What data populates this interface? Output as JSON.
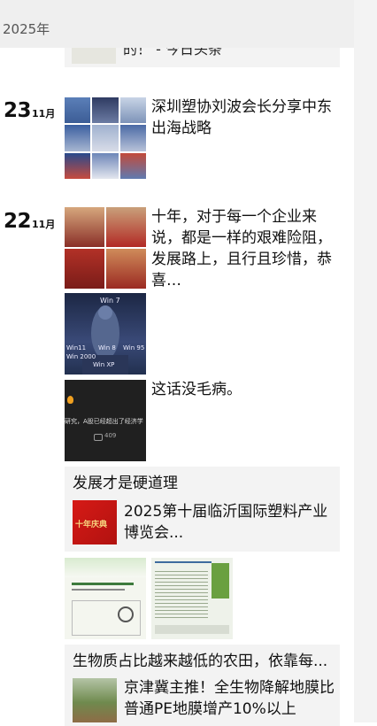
{
  "header": {
    "year": "2025年"
  },
  "top_card": {
    "text": "的！ - 今日头条"
  },
  "posts": [
    {
      "day": "23",
      "month": "11月",
      "text": "深圳塑协刘波会长分享中东出海战略"
    },
    {
      "day": "22",
      "month": "11月",
      "text": "十年，对于每一个企业来说，都是一样的艰难险阻，发展路上，且行且珍惜，恭喜…",
      "image_labels": [
        "Win 7",
        "Win11",
        "Win 8",
        "Win 95",
        "Win 2000",
        "Win XP"
      ],
      "video_text": "这话没毛病。",
      "video_caption": "研究，A股已经超出了经济学",
      "video_count": "409"
    }
  ],
  "share_cards": [
    {
      "title": "发展才是硬道理",
      "link_text": "2025第十届临沂国际塑料产业博览会...",
      "thumb_label": "十年庆典"
    },
    {
      "title": "生物质占比越来越低的农田，依靠每...",
      "link_text": "京津冀主推！全生物降解地膜比普通PE地膜增产10%以上"
    }
  ],
  "colors": {
    "bg": "#ffffff",
    "card_bg": "#f3f3f3",
    "year_bar": "#efefef"
  }
}
